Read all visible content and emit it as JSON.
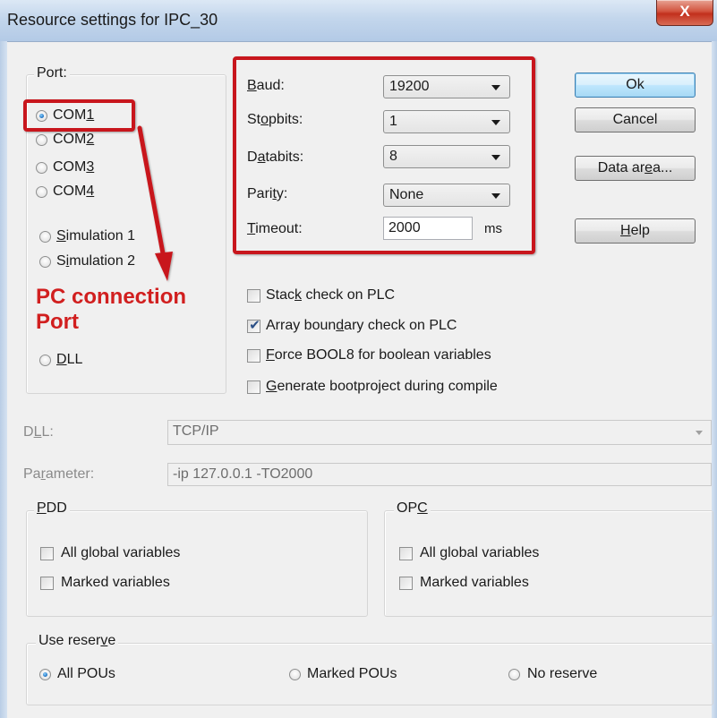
{
  "window": {
    "title": "Resource settings for IPC_30",
    "close_glyph": "X"
  },
  "port": {
    "group_label": "Port:",
    "options": [
      {
        "pre": "COM",
        "key": "1",
        "post": "",
        "checked": true
      },
      {
        "pre": "COM",
        "key": "2",
        "post": "",
        "checked": false
      },
      {
        "pre": "COM",
        "key": "3",
        "post": "",
        "checked": false
      },
      {
        "pre": "COM",
        "key": "4",
        "post": "",
        "checked": false
      },
      {
        "pre": "",
        "key": "S",
        "post": "imulation 1",
        "checked": false
      },
      {
        "pre": "S",
        "key": "i",
        "post": "mulation 2",
        "checked": false
      },
      {
        "pre": "",
        "key": "D",
        "post": "LL",
        "checked": false
      }
    ]
  },
  "serial": {
    "baud": {
      "pre": "",
      "key": "B",
      "post": "aud:",
      "value": "19200"
    },
    "stopbits": {
      "pre": "St",
      "key": "o",
      "post": "pbits:",
      "value": "1"
    },
    "databits": {
      "pre": "D",
      "key": "a",
      "post": "tabits:",
      "value": "8"
    },
    "parity": {
      "pre": "Pari",
      "key": "t",
      "post": "y:",
      "value": "None"
    },
    "timeout": {
      "pre": "",
      "key": "T",
      "post": "imeout:",
      "value": "2000",
      "unit": "ms"
    }
  },
  "buttons": {
    "ok": "Ok",
    "cancel": "Cancel",
    "data_area": {
      "pre": "Data ar",
      "key": "e",
      "post": "a..."
    },
    "help": {
      "pre": "",
      "key": "H",
      "post": "elp"
    }
  },
  "checks": [
    {
      "pre": "Stac",
      "key": "k",
      "post": " check on PLC",
      "checked": false
    },
    {
      "pre": "Array boun",
      "key": "d",
      "post": "ary check on PLC",
      "checked": true
    },
    {
      "pre": "",
      "key": "F",
      "post": "orce BOOL8 for boolean variables",
      "checked": false
    },
    {
      "pre": "",
      "key": "G",
      "post": "enerate bootproject during compile",
      "checked": false
    }
  ],
  "dll": {
    "pre": "D",
    "key": "L",
    "post": "L:",
    "value": "TCP/IP"
  },
  "parameter": {
    "pre": "Pa",
    "key": "r",
    "post": "ameter:",
    "value": "-ip 127.0.0.1 -TO2000"
  },
  "pdd": {
    "title": {
      "pre": "",
      "key": "P",
      "post": "DD"
    },
    "all_global": "All global variables",
    "marked": "Marked variables"
  },
  "opc": {
    "title": {
      "pre": "OP",
      "key": "C",
      "post": ""
    },
    "all_global": "All global variables",
    "marked": "Marked variables"
  },
  "reserve": {
    "title": {
      "pre": "Use reser",
      "key": "v",
      "post": "e"
    },
    "options": [
      {
        "label": "All POUs",
        "checked": true
      },
      {
        "label": "Marked POUs",
        "checked": false
      },
      {
        "label": "No reserve",
        "checked": false
      }
    ]
  },
  "annotation": {
    "line1": "PC connection",
    "line2": "Port"
  },
  "colors": {
    "annotation_red": "#c8161d",
    "title_bar": "#c3d6ec",
    "radio_dot": "#1b6fc0"
  }
}
